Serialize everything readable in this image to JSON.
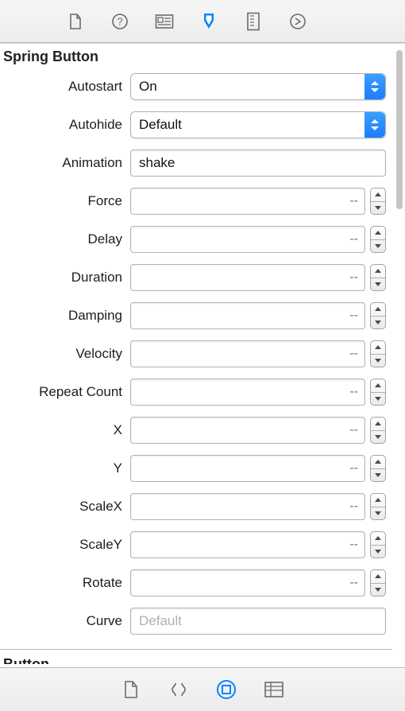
{
  "section": {
    "title": "Spring Button"
  },
  "props": {
    "autostart": {
      "label": "Autostart",
      "value": "On"
    },
    "autohide": {
      "label": "Autohide",
      "value": "Default"
    },
    "animation": {
      "label": "Animation",
      "value": "shake"
    },
    "force": {
      "label": "Force",
      "placeholder": "--"
    },
    "delay": {
      "label": "Delay",
      "placeholder": "--"
    },
    "duration": {
      "label": "Duration",
      "placeholder": "--"
    },
    "damping": {
      "label": "Damping",
      "placeholder": "--"
    },
    "velocity": {
      "label": "Velocity",
      "placeholder": "--"
    },
    "repeatcount": {
      "label": "Repeat Count",
      "placeholder": "--"
    },
    "x": {
      "label": "X",
      "placeholder": "--"
    },
    "y": {
      "label": "Y",
      "placeholder": "--"
    },
    "scalex": {
      "label": "ScaleX",
      "placeholder": "--"
    },
    "scaley": {
      "label": "ScaleY",
      "placeholder": "--"
    },
    "rotate": {
      "label": "Rotate",
      "placeholder": "--"
    },
    "curve": {
      "label": "Curve",
      "placeholder": "Default"
    }
  },
  "next_section": {
    "title": "Button"
  },
  "top_tabs": {
    "file": "file-icon",
    "help": "help-icon",
    "identity": "identity-icon",
    "attributes": "attributes-icon",
    "size": "size-icon",
    "connections": "connections-icon"
  },
  "bottom_tabs": {
    "file": "file-icon",
    "code": "code-icon",
    "object": "object-icon",
    "library": "library-icon"
  }
}
